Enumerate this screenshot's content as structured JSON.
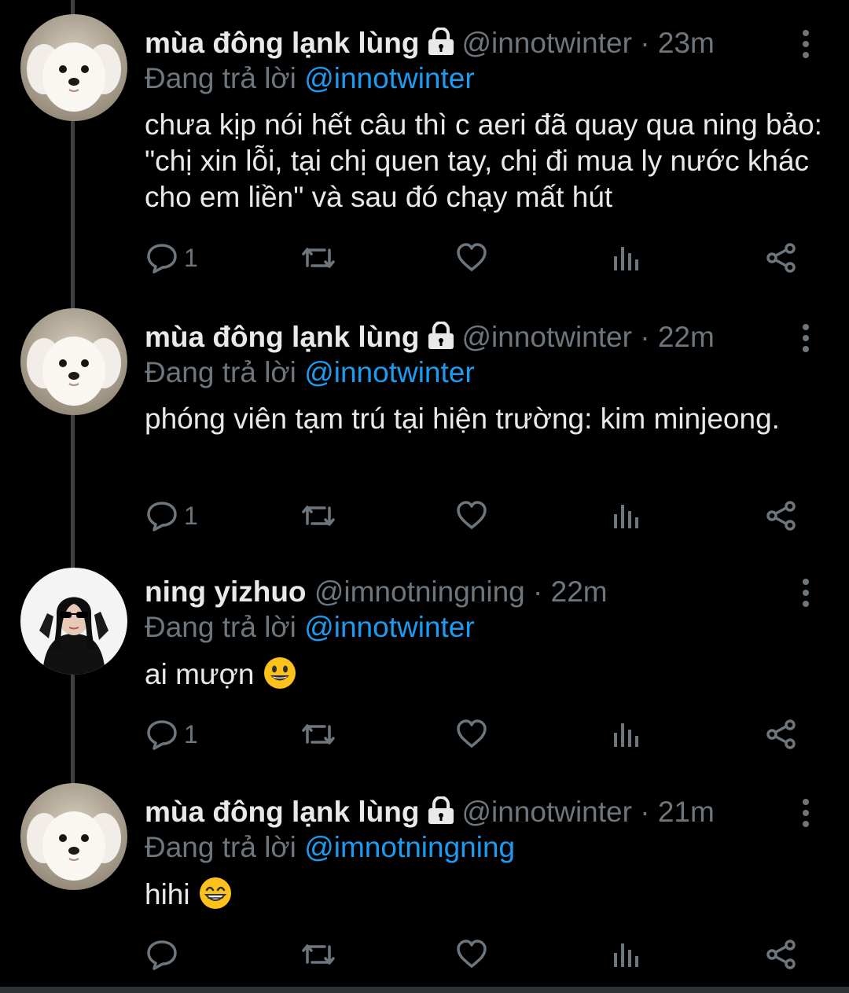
{
  "reply_prefix": "Đang trả lời",
  "tweets": [
    {
      "author": "mùa đông lạnk lùng",
      "protected": true,
      "handle": "@innotwinter",
      "time": "23m",
      "reply_to": "@innotwinter",
      "text": "chưa kịp nói hết câu thì c aeri đã quay qua ning bảo: \"chị xin lỗi, tại chị quen tay, chị đi mua ly nước khác cho em liền\" và sau đó chạy mất hút",
      "reply_count": "1",
      "avatar": "puppy"
    },
    {
      "author": "mùa đông lạnk lùng",
      "protected": true,
      "handle": "@innotwinter",
      "time": "22m",
      "reply_to": "@innotwinter",
      "text": "phóng viên tạm trú tại hiện trường: kim minjeong.",
      "reply_count": "1",
      "avatar": "puppy"
    },
    {
      "author": "ning yizhuo",
      "protected": false,
      "handle": "@imnotningning",
      "time": "22m",
      "reply_to": "@innotwinter",
      "text": "ai mượn",
      "emoji": "grinning-face",
      "reply_count": "1",
      "avatar": "girl"
    },
    {
      "author": "mùa đông lạnk lùng",
      "protected": true,
      "handle": "@innotwinter",
      "time": "21m",
      "reply_to": "@imnotningning",
      "text": "hihi",
      "emoji": "beaming-face",
      "reply_count": "",
      "avatar": "puppy"
    }
  ],
  "icons": [
    "reply-icon",
    "retweet-icon",
    "like-icon",
    "analytics-icon",
    "share-icon",
    "more-icon",
    "lock-icon"
  ],
  "colors": {
    "background": "#000000",
    "text": "#e7e9ea",
    "muted": "#6e767d",
    "link": "#1d9bf0"
  }
}
